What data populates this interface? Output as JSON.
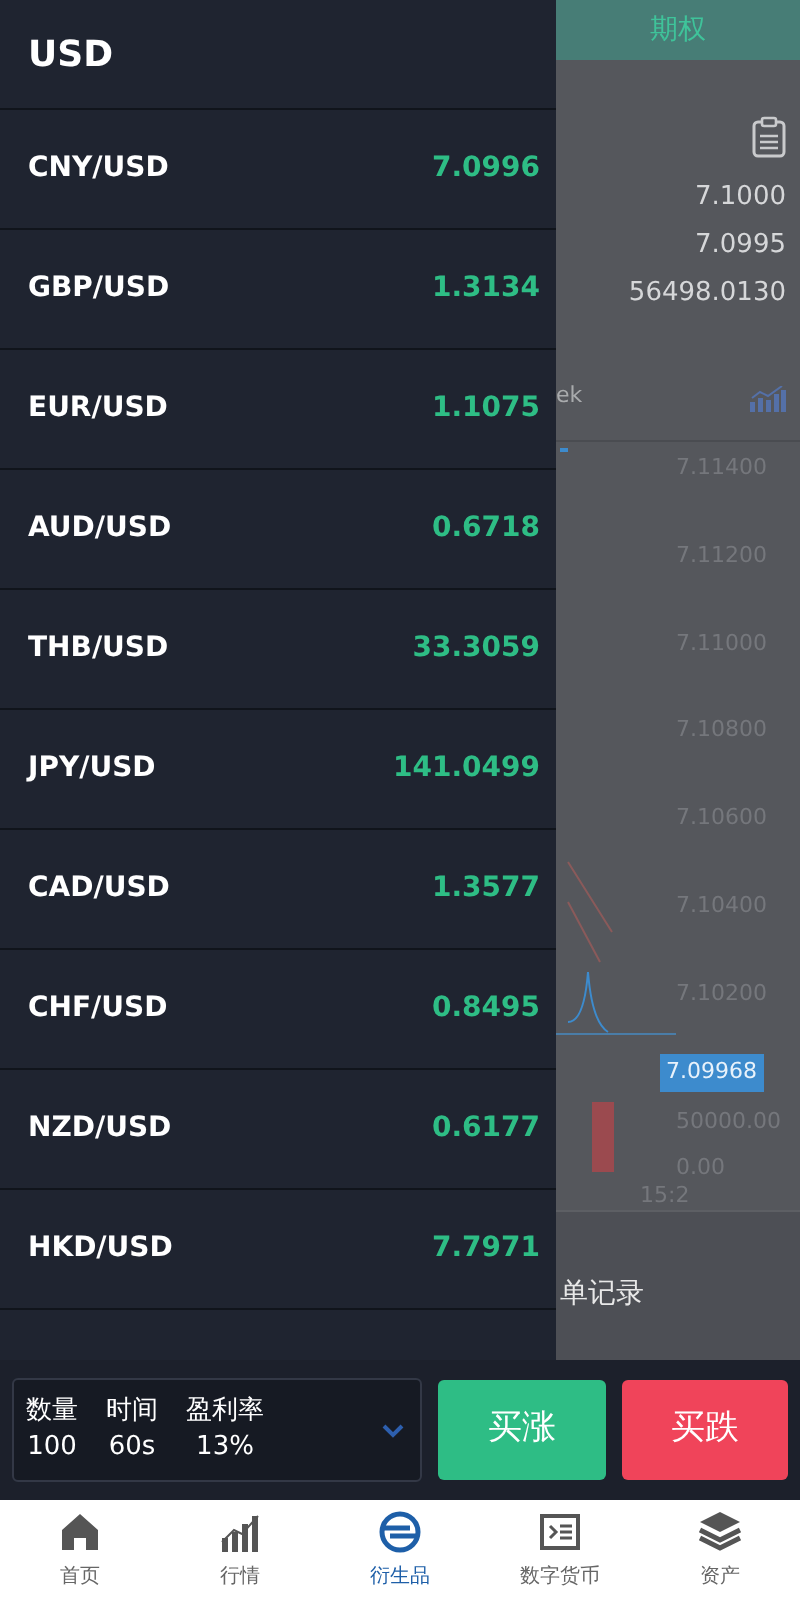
{
  "drawer": {
    "title": "USD",
    "pairs": [
      {
        "name": "CNY/USD",
        "price": "7.0996"
      },
      {
        "name": "GBP/USD",
        "price": "1.3134"
      },
      {
        "name": "EUR/USD",
        "price": "1.1075"
      },
      {
        "name": "AUD/USD",
        "price": "0.6718"
      },
      {
        "name": "THB/USD",
        "price": "33.3059"
      },
      {
        "name": "JPY/USD",
        "price": "141.0499"
      },
      {
        "name": "CAD/USD",
        "price": "1.3577"
      },
      {
        "name": "CHF/USD",
        "price": "0.8495"
      },
      {
        "name": "NZD/USD",
        "price": "0.6177"
      },
      {
        "name": "HKD/USD",
        "price": "7.7971"
      }
    ]
  },
  "background_page": {
    "tab": "期权",
    "prices": [
      "7.1000",
      "7.0995",
      "56498.0130"
    ],
    "period_label": "ek",
    "chart": {
      "axis_labels": [
        "7.11400",
        "7.11200",
        "7.11000",
        "7.10800",
        "7.10600",
        "7.10400",
        "7.10200"
      ],
      "current_price": "7.09968",
      "volume_labels": [
        "50000.00",
        "0.00"
      ],
      "time_label": "15:2"
    },
    "section_title": "单记录"
  },
  "trade_bar": {
    "fields": [
      {
        "label": "数量",
        "value": "100"
      },
      {
        "label": "时间",
        "value": "60s"
      },
      {
        "label": "盈利率",
        "value": "13%"
      }
    ],
    "buy_up": "买涨",
    "buy_down": "买跌"
  },
  "bottom_nav": [
    {
      "label": "首页",
      "selected": false
    },
    {
      "label": "行情",
      "selected": false
    },
    {
      "label": "衍生品",
      "selected": true
    },
    {
      "label": "数字货币",
      "selected": false
    },
    {
      "label": "资产",
      "selected": false
    }
  ]
}
